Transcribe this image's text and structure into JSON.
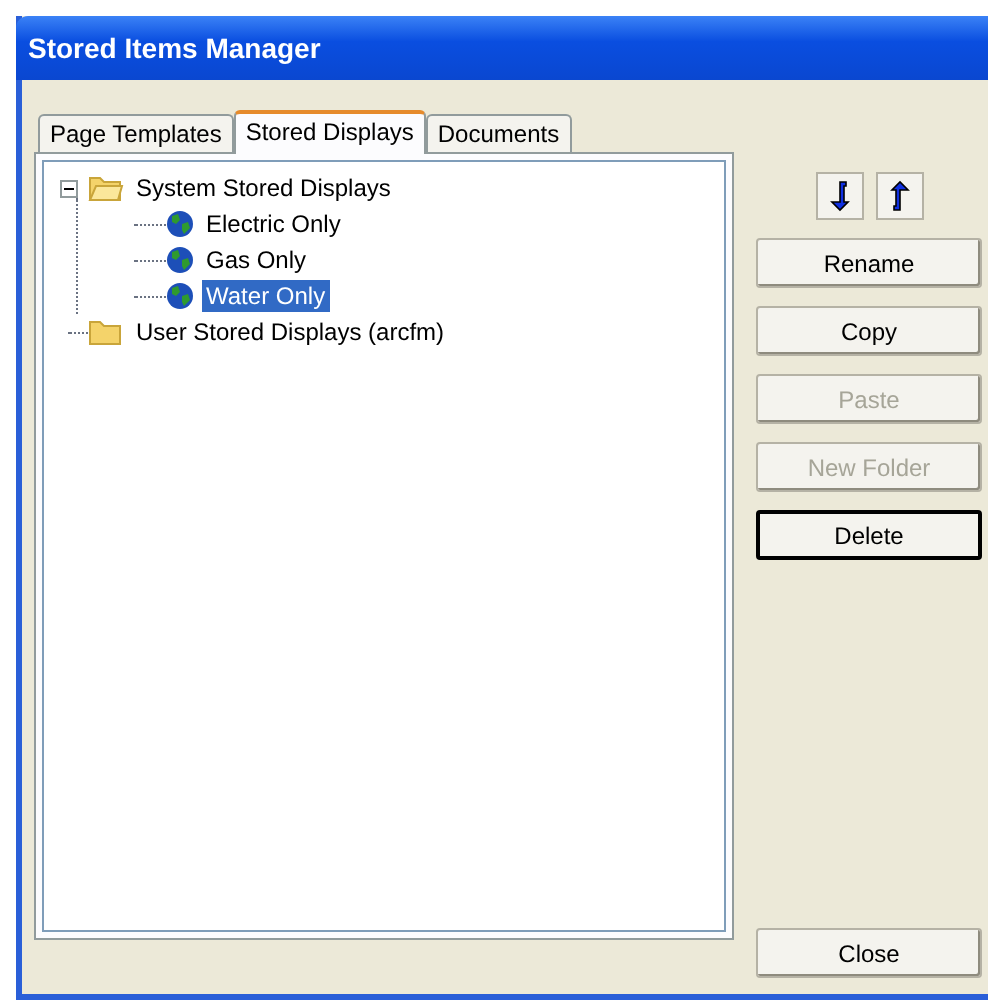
{
  "window": {
    "title": "Stored Items Manager"
  },
  "tabs": [
    {
      "label": "Page Templates",
      "selected": false
    },
    {
      "label": "Stored Displays",
      "selected": true
    },
    {
      "label": "Documents",
      "selected": false
    }
  ],
  "tree": [
    {
      "label": "System Stored Displays",
      "kind": "folder",
      "expanded": true,
      "selected": false,
      "children": [
        {
          "label": "Electric Only",
          "kind": "display",
          "selected": false
        },
        {
          "label": "Gas Only",
          "kind": "display",
          "selected": false
        },
        {
          "label": "Water Only",
          "kind": "display",
          "selected": true
        }
      ]
    },
    {
      "label": "User Stored Displays (arcfm)",
      "kind": "folder",
      "selected": false
    }
  ],
  "buttons": [
    {
      "label": "Rename",
      "disabled": false,
      "default": false
    },
    {
      "label": "Copy",
      "disabled": false,
      "default": false
    },
    {
      "label": "Paste",
      "disabled": true,
      "default": false
    },
    {
      "label": "New Folder",
      "disabled": true,
      "default": false
    },
    {
      "label": "Delete",
      "disabled": false,
      "default": true
    }
  ],
  "close_button": {
    "label": "Close"
  }
}
